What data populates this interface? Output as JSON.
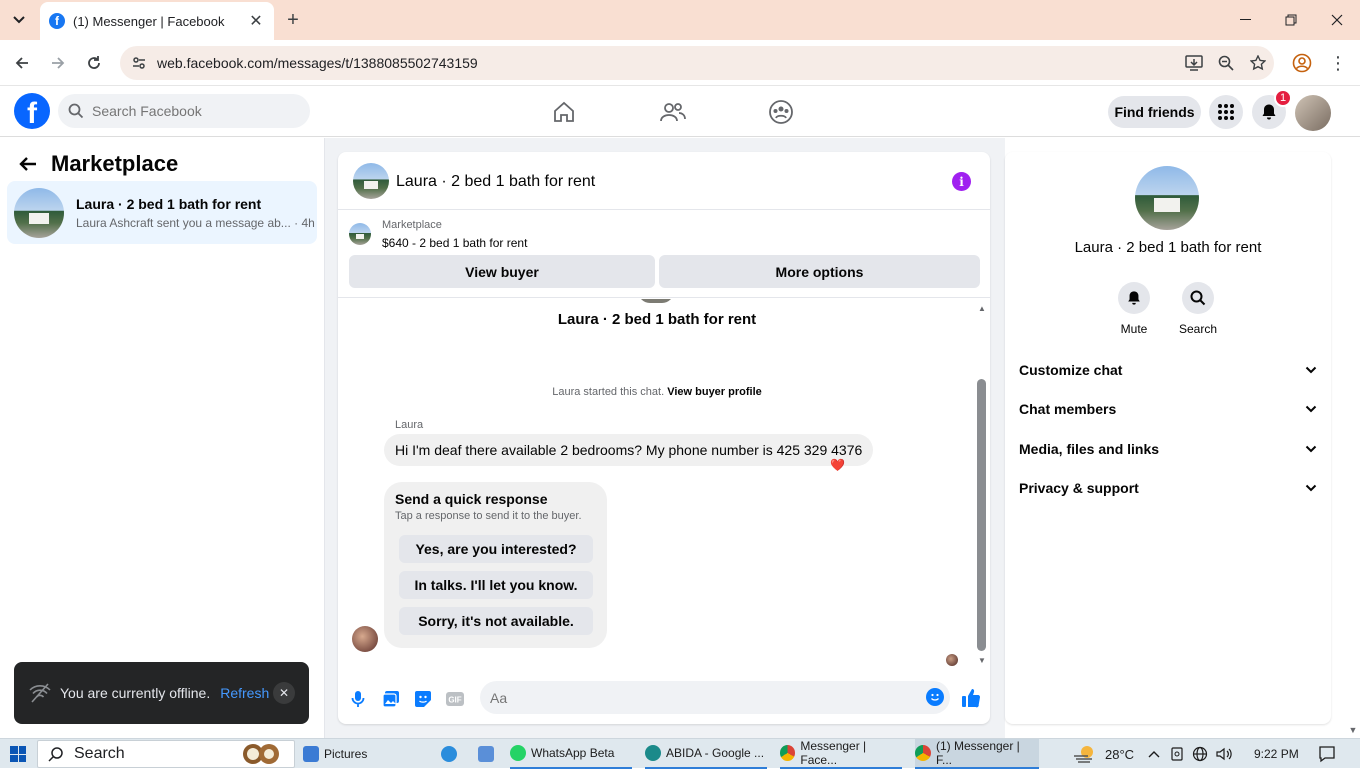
{
  "browser": {
    "tab_title": "(1) Messenger | Facebook",
    "url": "web.facebook.com/messages/t/1388085502743159"
  },
  "fb_header": {
    "search_placeholder": "Search Facebook",
    "find_friends": "Find friends",
    "notification_count": "1"
  },
  "left_panel": {
    "title": "Marketplace",
    "conversations": [
      {
        "name": "Laura · 2 bed 1 bath for rent",
        "snippet": "Laura Ashcraft sent you a message ab...",
        "time": "4h"
      }
    ]
  },
  "chat": {
    "header_title": "Laura · 2 bed 1 bath for rent",
    "listing_source": "Marketplace",
    "listing_price_title": "$640 - 2 bed 1 bath for rent",
    "view_buyer": "View buyer",
    "more_options": "More options",
    "thread_title": "Laura · 2 bed 1 bath for rent",
    "started_text": "Laura started this chat.",
    "view_buyer_profile": "View buyer profile",
    "sender": "Laura",
    "message": "Hi I'm deaf there available 2 bedrooms? My phone number is 425 329 4376",
    "reaction": "❤️",
    "quick_title": "Send a quick response",
    "quick_subtitle": "Tap a response to send it to the buyer.",
    "quick_responses": [
      "Yes, are you interested?",
      "In talks. I'll let you know.",
      "Sorry, it's not available."
    ],
    "composer_placeholder": "Aa"
  },
  "right_panel": {
    "title": "Laura · 2 bed 1 bath for rent",
    "mute": "Mute",
    "search": "Search",
    "sections": [
      "Customize chat",
      "Chat members",
      "Media, files and links",
      "Privacy & support"
    ]
  },
  "toast": {
    "message": "You are currently offline.",
    "action": "Refresh"
  },
  "taskbar": {
    "search": "Search",
    "items": [
      "Pictures",
      "WhatsApp Beta",
      "ABIDA - Google ...",
      "Messenger | Face...",
      "(1) Messenger | F..."
    ],
    "temperature": "28°C",
    "time": "9:22 PM"
  },
  "colors": {
    "fb_blue": "#0866ff",
    "active_conversation_bg": "#ebf5ff",
    "info_purple": "#a020f0",
    "messenger_blue": "#0a7cff",
    "toast_bg": "#242526"
  }
}
